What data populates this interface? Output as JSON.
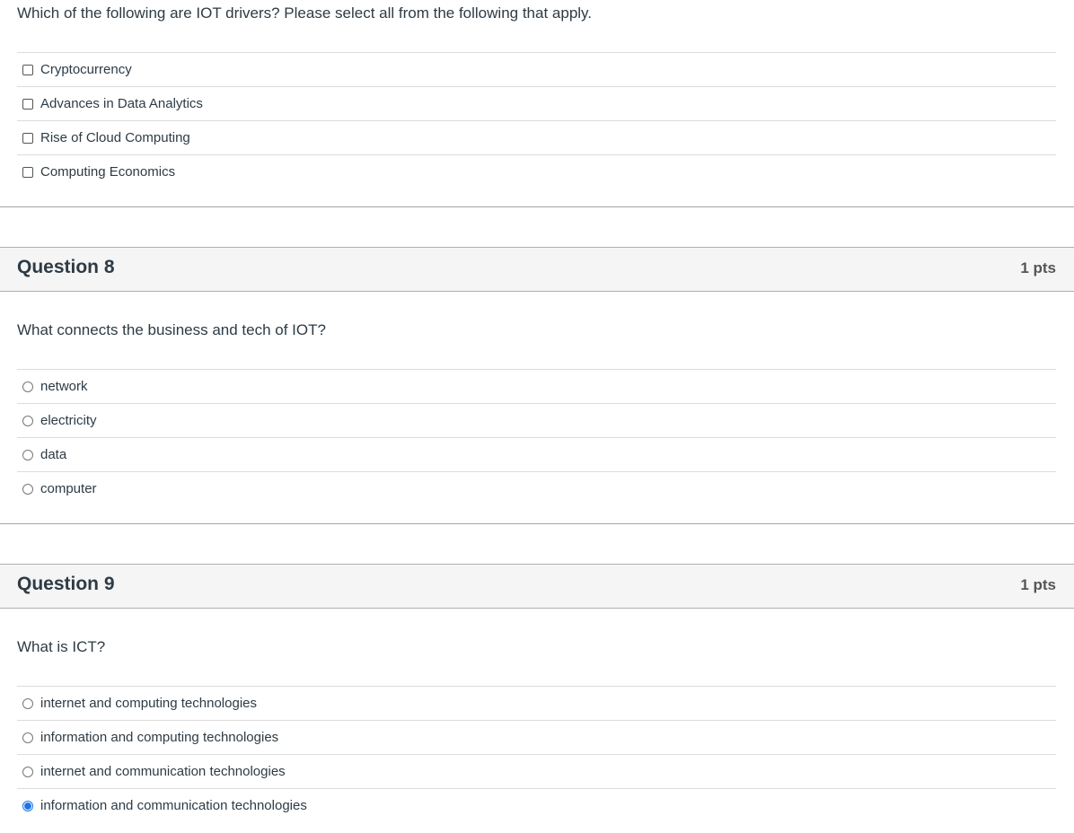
{
  "question7": {
    "text": "Which of the following are IOT drivers? Please select all from the following that apply.",
    "type": "checkbox",
    "answers": [
      {
        "label": "Cryptocurrency",
        "checked": false
      },
      {
        "label": "Advances in Data Analytics",
        "checked": false
      },
      {
        "label": "Rise of Cloud Computing",
        "checked": false
      },
      {
        "label": "Computing Economics",
        "checked": false
      }
    ]
  },
  "question8": {
    "title": "Question 8",
    "points": "1 pts",
    "text": "What connects the business and tech of IOT?",
    "type": "radio",
    "answers": [
      {
        "label": "network",
        "checked": false
      },
      {
        "label": "electricity",
        "checked": false
      },
      {
        "label": "data",
        "checked": false
      },
      {
        "label": "computer",
        "checked": false
      }
    ]
  },
  "question9": {
    "title": "Question 9",
    "points": "1 pts",
    "text": "What is ICT?",
    "type": "radio",
    "answers": [
      {
        "label": "internet and computing technologies",
        "checked": false
      },
      {
        "label": "information and computing technologies",
        "checked": false
      },
      {
        "label": "internet and communication technologies",
        "checked": false
      },
      {
        "label": "information and communication technologies",
        "checked": true
      }
    ]
  },
  "colors": {
    "accent": "#1a73e8",
    "text": "#2d3b45",
    "header_bg": "#f5f5f5"
  }
}
